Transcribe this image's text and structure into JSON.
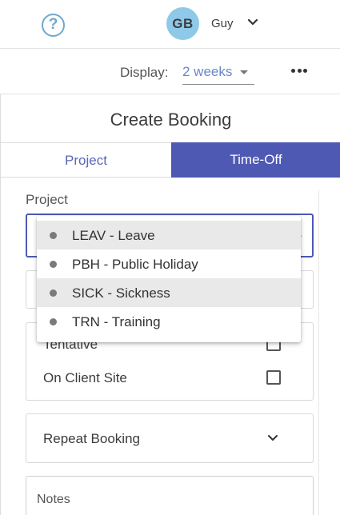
{
  "header": {
    "help_icon": "question-circle-icon",
    "avatar_initials": "GB",
    "avatar_color": "#8ec9e9",
    "username": "Guy",
    "user_menu_icon": "chevron-down-icon"
  },
  "display": {
    "label": "Display:",
    "value": "2 weeks",
    "more_icon": "more-horizontal-icon"
  },
  "panel": {
    "title": "Create Booking",
    "tabs": [
      {
        "label": "Project",
        "active": false
      },
      {
        "label": "Time-Off",
        "active": true
      }
    ],
    "accent_color": "#4d59b3",
    "project_label": "Project",
    "options": [
      {
        "label": "LEAV - Leave",
        "highlighted": true
      },
      {
        "label": "PBH - Public Holiday",
        "highlighted": false
      },
      {
        "label": "SICK - Sickness",
        "highlighted": true
      },
      {
        "label": "TRN - Training",
        "highlighted": false
      }
    ],
    "checkboxes": [
      {
        "label": "Tentative",
        "checked": false
      },
      {
        "label": "On Client Site",
        "checked": false
      }
    ],
    "repeat_label": "Repeat Booking",
    "notes_placeholder": "Notes"
  }
}
